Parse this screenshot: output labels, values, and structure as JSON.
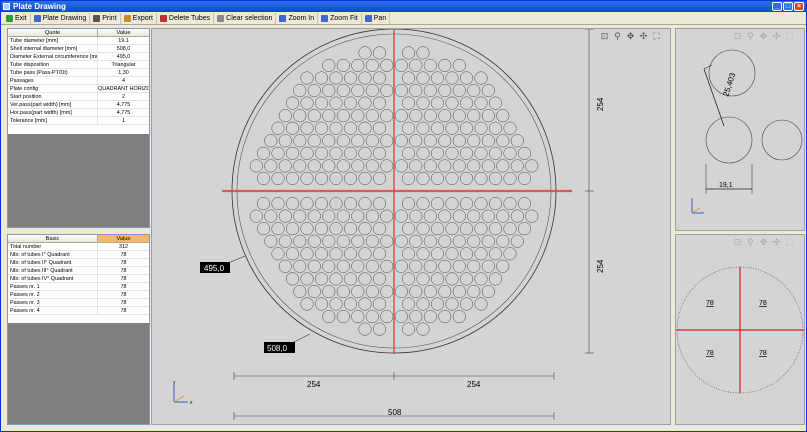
{
  "window": {
    "title": "Plate Drawing"
  },
  "toolbar": {
    "items": [
      {
        "label": "Exit",
        "color": "#2e9e2e"
      },
      {
        "label": "Plate Drawing",
        "color": "#3a6ad0"
      },
      {
        "label": "Print",
        "color": "#555555"
      },
      {
        "label": "Export",
        "color": "#d08a2e"
      },
      {
        "label": "Delete Tubes",
        "color": "#c03030"
      },
      {
        "label": "Clear selection",
        "color": "#888888"
      },
      {
        "label": "Zoom In",
        "color": "#3a6ad0"
      },
      {
        "label": "Zoom Fit",
        "color": "#3a6ad0"
      },
      {
        "label": "Pan",
        "color": "#3a6ad0"
      }
    ]
  },
  "quote_table": {
    "headers": [
      "Quote",
      "Value"
    ],
    "rows": [
      [
        "Tube diameter [mm]",
        "19,1"
      ],
      [
        "Shell internal diameter [mm]",
        "508,0"
      ],
      [
        "Diameter External circumference [mm]",
        "495,0"
      ],
      [
        "Tube disposition",
        "Triangular"
      ],
      [
        "Tube pass (Pass-PT/Dt)",
        "1,30"
      ],
      [
        "Passages",
        "4"
      ],
      [
        "Plate config",
        "QUADRANT HORIZONTAL"
      ],
      [
        "Start position",
        "2"
      ],
      [
        "Ver.pass(part width) [mm]",
        "4,775"
      ],
      [
        "Hor.pass(part width) [mm]",
        "4,775"
      ],
      [
        "Tolerance [mm]",
        "1"
      ]
    ]
  },
  "tubes_table": {
    "headers": [
      "Basic",
      "Value"
    ],
    "rows": [
      [
        "Total number",
        "312"
      ],
      [
        "Nbr. of tubes I° Quadrant",
        "78"
      ],
      [
        "Nbr. of tubes II° Quadrant",
        "78"
      ],
      [
        "Nbr. of tubes III° Quadrant",
        "78"
      ],
      [
        "Nbr. of tubes IV° Quadrant",
        "78"
      ],
      [
        "Passes nr. 1",
        "78"
      ],
      [
        "Passes nr. 2",
        "78"
      ],
      [
        "Passes nr. 3",
        "78"
      ],
      [
        "Passes nr. 4",
        "78"
      ]
    ]
  },
  "main_drawing": {
    "label_external": "495,0",
    "label_shell": "508,0",
    "dim_top_right": "254",
    "dim_bottom_right": "254",
    "dim_bottom_left": "254",
    "dim_bottom_mid": "254",
    "dim_total": "508",
    "axis_y": "y",
    "axis_x": "x",
    "divider_color": "#e84040"
  },
  "detail_view": {
    "pitch_label": "25,403",
    "diameter_label": "19,1"
  },
  "quadrant_view": {
    "q1": "78",
    "q2": "78",
    "q3": "78",
    "q4": "78"
  },
  "view_tool_icons": [
    "zoom-window-icon",
    "zoom-icon",
    "pan-icon",
    "move-icon",
    "fit-icon"
  ]
}
